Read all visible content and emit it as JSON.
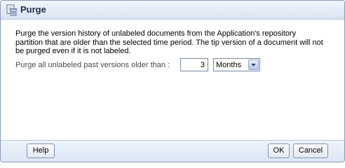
{
  "dialog": {
    "title": "Purge",
    "title_icon": "purge-document-icon",
    "description": "Purge the version history of unlabeled documents from the Application's repository partition that are older than the selected time period. The tip version of a document will not be purged even if it is not labeled.",
    "age_label": "Purge all unlabeled past versions older than :",
    "age_value": "3",
    "age_unit": "Months"
  },
  "footer": {
    "help_label": "Help",
    "ok_label": "OK",
    "cancel_label": "Cancel"
  }
}
